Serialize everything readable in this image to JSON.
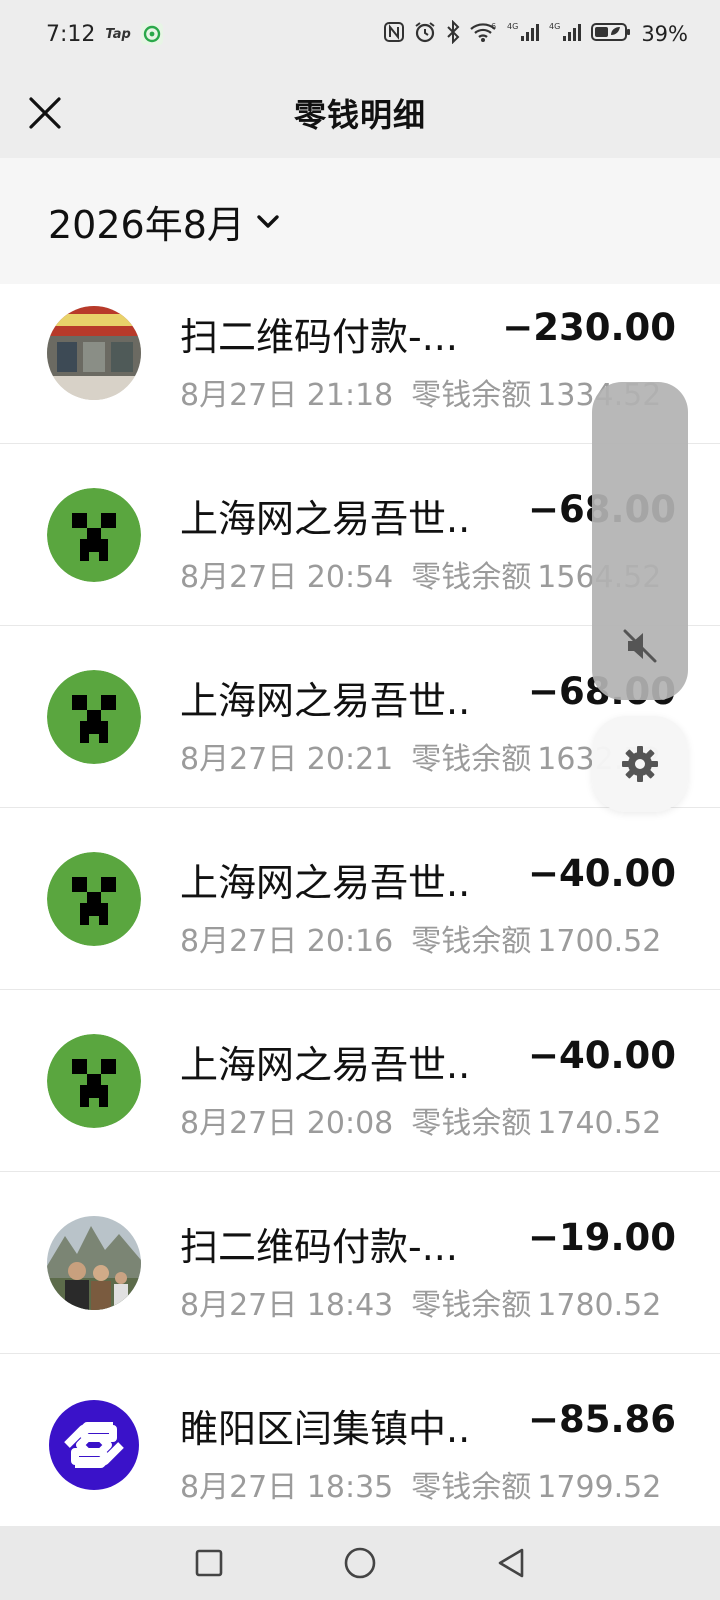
{
  "status_bar": {
    "time": "7:12",
    "tap_label": "Tap",
    "battery": "39%",
    "icons": [
      "nfc-icon",
      "alarm-icon",
      "bluetooth-icon",
      "wifi-icon",
      "signal-4g-icon",
      "signal-4g-icon",
      "battery-icon"
    ]
  },
  "header": {
    "title": "零钱明细",
    "close_icon": "close-icon"
  },
  "filter": {
    "month": "2026年8月",
    "dropdown_icon": "chevron-down-icon"
  },
  "transactions": [
    {
      "name": "扫二维码付款-...",
      "amount": "−230.00",
      "time": "8月27日 21:18",
      "balance_label": "零钱余额",
      "balance": "1334.52",
      "avatar": "shop-photo"
    },
    {
      "name": "上海网之易吾世...",
      "amount": "−68.00",
      "time": "8月27日 20:54",
      "balance_label": "零钱余额",
      "balance": "1564.52",
      "avatar": "creeper"
    },
    {
      "name": "上海网之易吾世...",
      "amount": "−68.00",
      "time": "8月27日 20:21",
      "balance_label": "零钱余额",
      "balance": "1632.52",
      "avatar": "creeper"
    },
    {
      "name": "上海网之易吾世...",
      "amount": "−40.00",
      "time": "8月27日 20:16",
      "balance_label": "零钱余额",
      "balance": "1700.52",
      "avatar": "creeper"
    },
    {
      "name": "上海网之易吾世...",
      "amount": "−40.00",
      "time": "8月27日 20:08",
      "balance_label": "零钱余额",
      "balance": "1740.52",
      "avatar": "creeper"
    },
    {
      "name": "扫二维码付款-...",
      "amount": "−19.00",
      "time": "8月27日 18:43",
      "balance_label": "零钱余额",
      "balance": "1780.52",
      "avatar": "people-photo"
    },
    {
      "name": "睢阳区闫集镇中...",
      "amount": "−85.86",
      "time": "8月27日 18:35",
      "balance_label": "零钱余额",
      "balance": "1799.52",
      "avatar": "bank-logo"
    }
  ],
  "floating": {
    "volume_icon": "mute-icon",
    "settings_icon": "gear-icon"
  },
  "nav": {
    "icons": [
      "recents-square-icon",
      "home-circle-icon",
      "back-triangle-icon"
    ]
  },
  "colors": {
    "header_bg": "#ededed",
    "filter_bg": "#f6f6f6",
    "creeper_green": "#5aa63f",
    "bank_logo": "#3a12c9",
    "muted_text": "#9b9b9b"
  }
}
